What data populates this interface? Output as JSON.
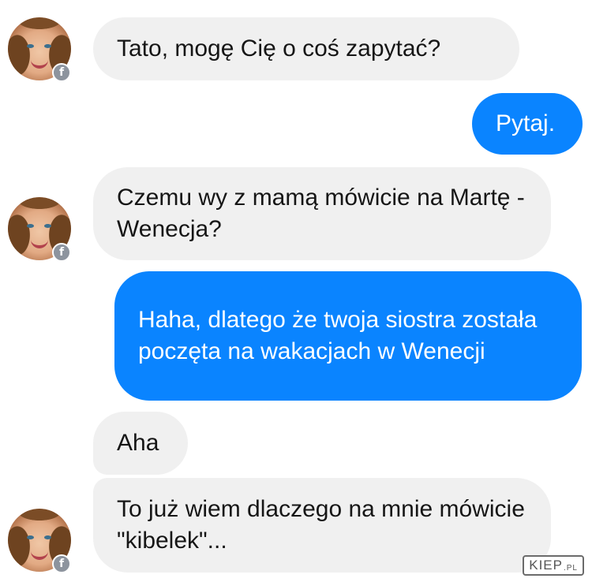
{
  "chat": {
    "messages": [
      {
        "sender": "incoming",
        "text": "Tato, mogę Cię o coś zapytać?"
      },
      {
        "sender": "outgoing",
        "text": "Pytaj."
      },
      {
        "sender": "incoming",
        "text": "Czemu wy z mamą mówicie na Martę - Wenecja?"
      },
      {
        "sender": "outgoing",
        "text": "Haha, dlatego że twoja siostra została poczęta na wakacjach w Wenecji"
      },
      {
        "sender": "incoming",
        "text": "Aha"
      },
      {
        "sender": "incoming",
        "text": "To już wiem dlaczego na mnie mówicie \"kibelek\"..."
      }
    ]
  },
  "avatar": {
    "badge_icon": "facebook-icon",
    "badge_glyph": "f"
  },
  "watermark": {
    "main": "KIEP",
    "suffix": ".PL"
  },
  "colors": {
    "incoming_bubble": "#f0f0f0",
    "outgoing_bubble": "#0a84ff",
    "incoming_text": "#161616",
    "outgoing_text": "#ffffff"
  }
}
